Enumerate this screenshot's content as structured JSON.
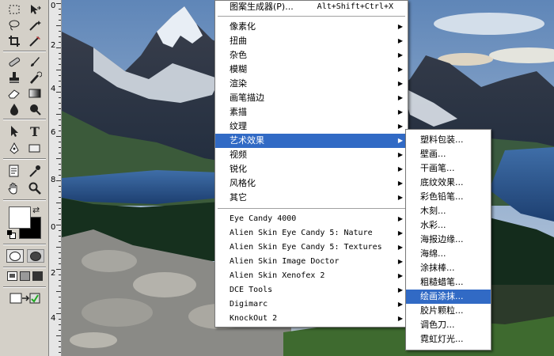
{
  "ruler": {
    "numbers": [
      "0",
      "2",
      "4",
      "6",
      "8",
      "0",
      "2",
      "4"
    ]
  },
  "toolbox": {
    "tools": [
      "marquee",
      "move",
      "lasso",
      "magic-wand",
      "crop",
      "slice",
      "healing-brush",
      "brush",
      "clone-stamp",
      "history-brush",
      "eraser",
      "gradient",
      "blur",
      "dodge",
      "path-selection",
      "type",
      "pen",
      "rectangle",
      "notes",
      "eyedropper",
      "hand",
      "zoom"
    ],
    "foreground_color": "#ffffff",
    "background_color": "#000000"
  },
  "filter_menu": {
    "top_item": {
      "label": "图案生成器(P)...",
      "shortcut": "Alt+Shift+Ctrl+X"
    },
    "items": [
      "像素化",
      "扭曲",
      "杂色",
      "模糊",
      "渲染",
      "画笔描边",
      "素描",
      "纹理",
      "艺术效果",
      "视频",
      "锐化",
      "风格化",
      "其它"
    ],
    "selected": "艺术效果",
    "plugins": [
      "Eye Candy 4000",
      "Alien Skin Eye Candy 5: Nature",
      "Alien Skin Eye Candy 5: Textures",
      "Alien Skin Image Doctor",
      "Alien Skin Xenofex 2",
      "DCE Tools",
      "Digimarc",
      "KnockOut 2"
    ]
  },
  "artistic_submenu": {
    "items": [
      "塑料包装...",
      "壁画...",
      "干画笔...",
      "底纹效果...",
      "彩色铅笔...",
      "木刻...",
      "水彩...",
      "海报边缘...",
      "海绵...",
      "涂抹棒...",
      "粗糙蜡笔...",
      "绘画涂抹...",
      "胶片颗粒...",
      "调色刀...",
      "霓虹灯光..."
    ],
    "selected": "绘画涂抹..."
  },
  "colors": {
    "highlight": "#316ac5",
    "toolbox_bg": "#d4d0c8"
  }
}
